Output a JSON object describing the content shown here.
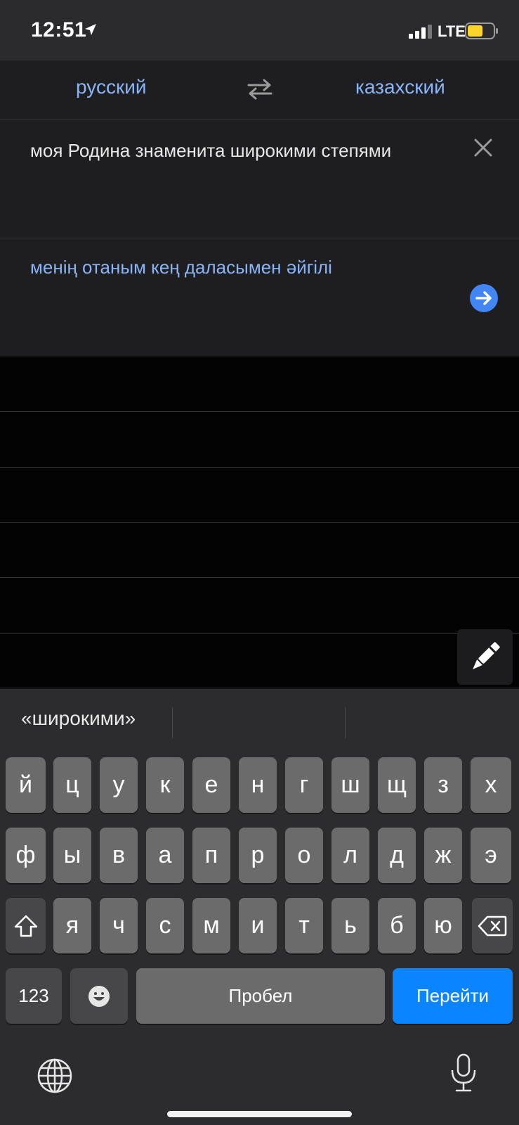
{
  "status_bar": {
    "time": "12:51",
    "network": "LTE",
    "battery_color": "#f9d42b"
  },
  "language_bar": {
    "source_language": "русский",
    "target_language": "казахский"
  },
  "input": {
    "text": "моя Родина знаменита широкими степями"
  },
  "output": {
    "text": "менің отаным кең даласымен әйгілі"
  },
  "keyboard": {
    "suggestions": [
      "«широкими»",
      "",
      ""
    ],
    "row1": [
      "й",
      "ц",
      "у",
      "к",
      "е",
      "н",
      "г",
      "ш",
      "щ",
      "з",
      "х"
    ],
    "row2": [
      "ф",
      "ы",
      "в",
      "а",
      "п",
      "р",
      "о",
      "л",
      "д",
      "ж",
      "э"
    ],
    "row3": [
      "я",
      "ч",
      "с",
      "м",
      "и",
      "т",
      "ь",
      "б",
      "ю"
    ],
    "numbers_label": "123",
    "space_label": "Пробел",
    "go_label": "Перейти"
  },
  "colors": {
    "accent_blue": "#8ab4f8",
    "go_button": "#0a84ff",
    "send_button": "#4285f4"
  }
}
